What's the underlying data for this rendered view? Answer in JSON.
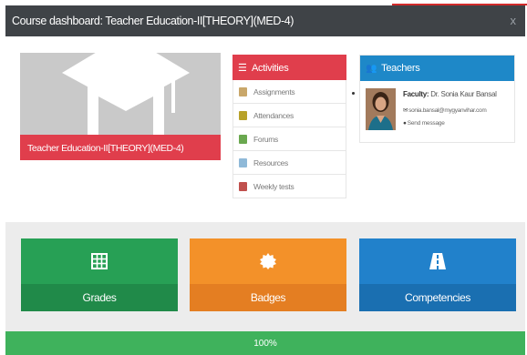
{
  "header": {
    "title": "Course dashboard: Teacher Education-II[THEORY](MED-4)",
    "close": "x"
  },
  "course": {
    "name": "Teacher Education-II[THEORY](MED-4)"
  },
  "activities": {
    "title": "Activities",
    "items": [
      {
        "label": "Assignments",
        "icon": "assignment-icon",
        "color": "#c9a76a"
      },
      {
        "label": "Attendances",
        "icon": "attendance-icon",
        "color": "#b8a22a"
      },
      {
        "label": "Forums",
        "icon": "forum-icon",
        "color": "#6aa84f"
      },
      {
        "label": "Resources",
        "icon": "resource-icon",
        "color": "#8fb9d8"
      },
      {
        "label": "Weekly tests",
        "icon": "quiz-icon",
        "color": "#c0504d"
      }
    ]
  },
  "teachers": {
    "title": "Teachers",
    "faculty_label": "Faculty:",
    "faculty_name": "Dr. Sonia Kaur Bansal",
    "email": "sonia.bansal@mygyanvihar.com",
    "send_message": "Send message"
  },
  "tiles": {
    "grades": {
      "label": "Grades",
      "color": "#27a055"
    },
    "badges": {
      "label": "Badges",
      "color": "#f39129"
    },
    "competencies": {
      "label": "Competencies",
      "color": "#2181cb"
    }
  },
  "progress": {
    "label": "100%",
    "value": 100
  }
}
